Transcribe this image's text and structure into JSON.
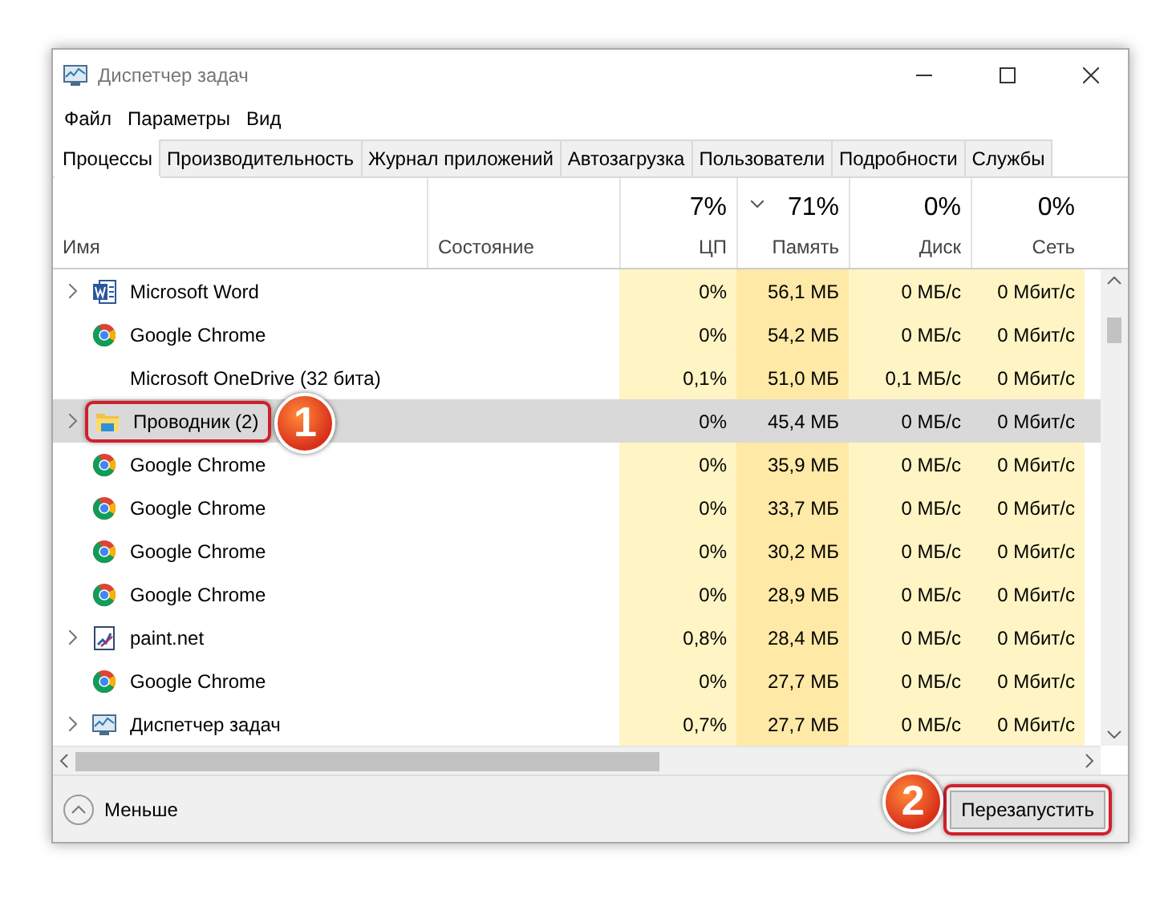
{
  "window": {
    "title": "Диспетчер задач"
  },
  "menu": [
    "Файл",
    "Параметры",
    "Вид"
  ],
  "tabs": [
    {
      "label": "Процессы",
      "selected": true
    },
    {
      "label": "Производительность",
      "selected": false
    },
    {
      "label": "Журнал приложений",
      "selected": false
    },
    {
      "label": "Автозагрузка",
      "selected": false
    },
    {
      "label": "Пользователи",
      "selected": false
    },
    {
      "label": "Подробности",
      "selected": false
    },
    {
      "label": "Службы",
      "selected": false
    }
  ],
  "columns": [
    {
      "label": "Имя",
      "sorted": false
    },
    {
      "label": "Состояние",
      "sorted": false
    },
    {
      "summary": "7%",
      "label": "ЦП",
      "sorted": false
    },
    {
      "summary": "71%",
      "label": "Память",
      "sorted": true
    },
    {
      "summary": "0%",
      "label": "Диск",
      "sorted": false
    },
    {
      "summary": "0%",
      "label": "Сеть",
      "sorted": false
    }
  ],
  "rows": [
    {
      "kind": "word",
      "expandable": true,
      "name": "Microsoft Word",
      "cpu": "0%",
      "memory": "56,1 МБ",
      "disk": "0 МБ/с",
      "network": "0 Мбит/с",
      "selected": false
    },
    {
      "kind": "chrome",
      "expandable": false,
      "name": "Google Chrome",
      "cpu": "0%",
      "memory": "54,2 МБ",
      "disk": "0 МБ/с",
      "network": "0 Мбит/с",
      "selected": false
    },
    {
      "kind": "none",
      "expandable": false,
      "name": "Microsoft OneDrive (32 бита)",
      "cpu": "0,1%",
      "memory": "51,0 МБ",
      "disk": "0,1 МБ/с",
      "network": "0 Мбит/с",
      "selected": false
    },
    {
      "kind": "explorer",
      "expandable": true,
      "name": "Проводник (2)",
      "cpu": "0%",
      "memory": "45,4 МБ",
      "disk": "0 МБ/с",
      "network": "0 Мбит/с",
      "selected": true,
      "callout": "1"
    },
    {
      "kind": "chrome",
      "expandable": false,
      "name": "Google Chrome",
      "cpu": "0%",
      "memory": "35,9 МБ",
      "disk": "0 МБ/с",
      "network": "0 Мбит/с",
      "selected": false
    },
    {
      "kind": "chrome",
      "expandable": false,
      "name": "Google Chrome",
      "cpu": "0%",
      "memory": "33,7 МБ",
      "disk": "0 МБ/с",
      "network": "0 Мбит/с",
      "selected": false
    },
    {
      "kind": "chrome",
      "expandable": false,
      "name": "Google Chrome",
      "cpu": "0%",
      "memory": "30,2 МБ",
      "disk": "0 МБ/с",
      "network": "0 Мбит/с",
      "selected": false
    },
    {
      "kind": "chrome",
      "expandable": false,
      "name": "Google Chrome",
      "cpu": "0%",
      "memory": "28,9 МБ",
      "disk": "0 МБ/с",
      "network": "0 Мбит/с",
      "selected": false
    },
    {
      "kind": "paint",
      "expandable": true,
      "name": "paint.net",
      "cpu": "0,8%",
      "memory": "28,4 МБ",
      "disk": "0 МБ/с",
      "network": "0 Мбит/с",
      "selected": false
    },
    {
      "kind": "chrome",
      "expandable": false,
      "name": "Google Chrome",
      "cpu": "0%",
      "memory": "27,7 МБ",
      "disk": "0 МБ/с",
      "network": "0 Мбит/с",
      "selected": false
    },
    {
      "kind": "taskmgr",
      "expandable": true,
      "name": "Диспетчер задач",
      "cpu": "0,7%",
      "memory": "27,7 МБ",
      "disk": "0 МБ/с",
      "network": "0 Мбит/с",
      "selected": false
    }
  ],
  "footer": {
    "fewer_details": "Меньше",
    "restart_button": "Перезапустить",
    "callout": "2"
  }
}
